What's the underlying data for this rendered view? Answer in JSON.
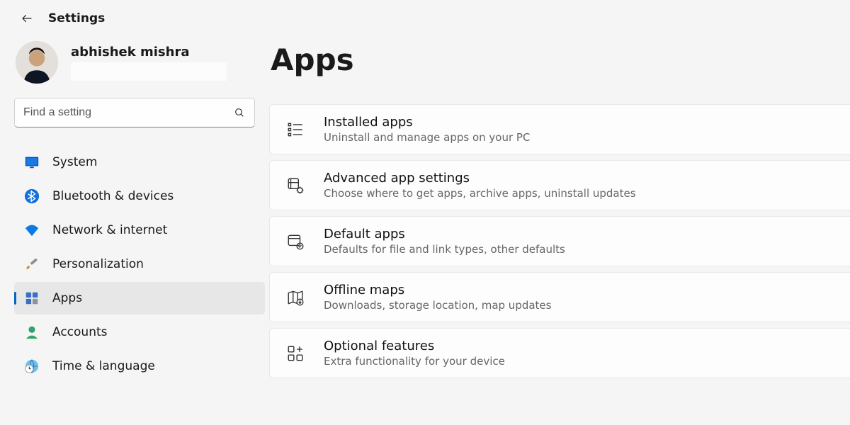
{
  "header": {
    "title": "Settings"
  },
  "user": {
    "name": "abhishek mishra"
  },
  "search": {
    "placeholder": "Find a setting"
  },
  "nav": {
    "items": [
      {
        "id": "system",
        "label": "System"
      },
      {
        "id": "bluetooth",
        "label": "Bluetooth & devices"
      },
      {
        "id": "network",
        "label": "Network & internet"
      },
      {
        "id": "personalization",
        "label": "Personalization"
      },
      {
        "id": "apps",
        "label": "Apps"
      },
      {
        "id": "accounts",
        "label": "Accounts"
      },
      {
        "id": "time-language",
        "label": "Time & language"
      }
    ],
    "selected": "apps"
  },
  "page": {
    "title": "Apps",
    "cards": [
      {
        "id": "installed-apps",
        "title": "Installed apps",
        "subtitle": "Uninstall and manage apps on your PC"
      },
      {
        "id": "advanced-app",
        "title": "Advanced app settings",
        "subtitle": "Choose where to get apps, archive apps, uninstall updates"
      },
      {
        "id": "default-apps",
        "title": "Default apps",
        "subtitle": "Defaults for file and link types, other defaults"
      },
      {
        "id": "offline-maps",
        "title": "Offline maps",
        "subtitle": "Downloads, storage location, map updates"
      },
      {
        "id": "optional-features",
        "title": "Optional features",
        "subtitle": "Extra functionality for your device"
      }
    ]
  }
}
